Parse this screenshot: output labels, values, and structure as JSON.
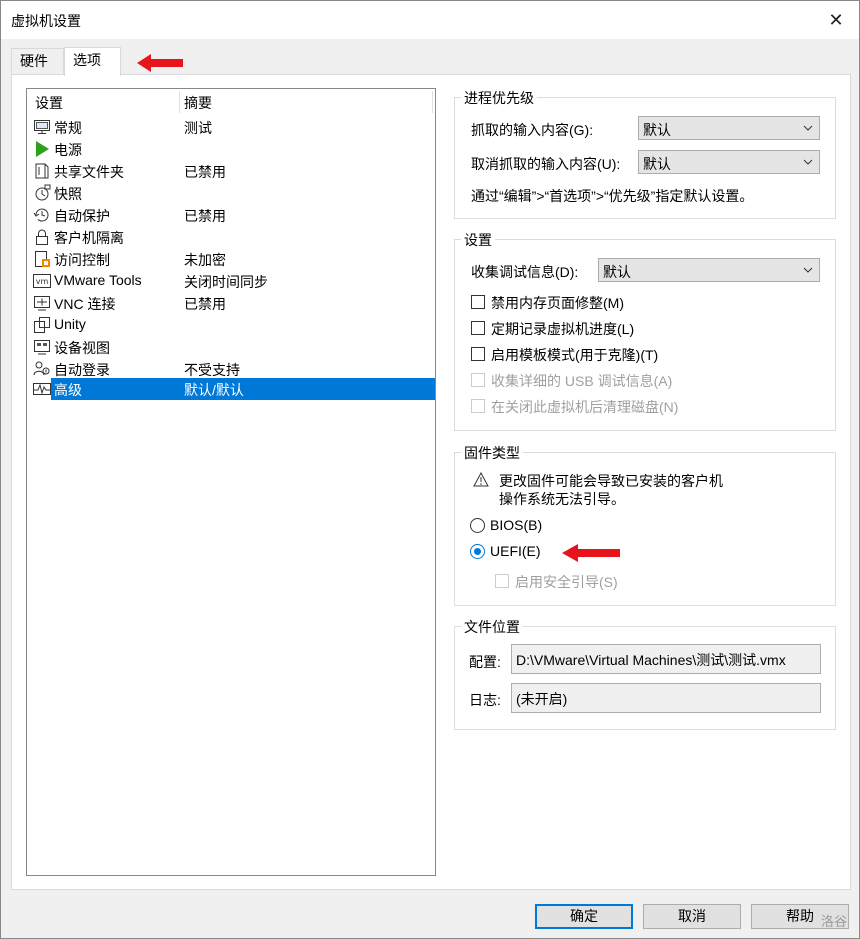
{
  "window": {
    "title": "虚拟机设置",
    "close_glyph": "✕"
  },
  "tabs": [
    {
      "label": "硬件"
    },
    {
      "label": "选项"
    }
  ],
  "list": {
    "headers": {
      "setting": "设置",
      "summary": "摘要"
    },
    "items": [
      {
        "name": "常规",
        "summary": "测试",
        "icon": "monitor-icon"
      },
      {
        "name": "电源",
        "summary": "",
        "icon": "play-icon"
      },
      {
        "name": "共享文件夹",
        "summary": "已禁用",
        "icon": "folder-share-icon"
      },
      {
        "name": "快照",
        "summary": "",
        "icon": "snapshot-icon"
      },
      {
        "name": "自动保护",
        "summary": "已禁用",
        "icon": "clock-icon"
      },
      {
        "name": "客户机隔离",
        "summary": "",
        "icon": "lock-icon"
      },
      {
        "name": "访问控制",
        "summary": "未加密",
        "icon": "access-control-icon"
      },
      {
        "name": "VMware Tools",
        "summary": "关闭时间同步",
        "icon": "vm-icon"
      },
      {
        "name": "VNC 连接",
        "summary": "已禁用",
        "icon": "vnc-icon"
      },
      {
        "name": "Unity",
        "summary": "",
        "icon": "unity-icon"
      },
      {
        "name": "设备视图",
        "summary": "",
        "icon": "device-view-icon"
      },
      {
        "name": "自动登录",
        "summary": "不受支持",
        "icon": "users-icon"
      },
      {
        "name": "高级",
        "summary": "默认/默认",
        "icon": "pulse-icon"
      }
    ],
    "selected_index": 12
  },
  "process_priority": {
    "title": "进程优先级",
    "grab_label": "抓取的输入内容(G):",
    "grab_value": "默认",
    "ungrab_label": "取消抓取的输入内容(U):",
    "ungrab_value": "默认",
    "hint": "通过“编辑”>“首选项”>“优先级”指定默认设置。"
  },
  "settings": {
    "title": "设置",
    "debug_label": "收集调试信息(D):",
    "debug_value": "默认",
    "checks": [
      {
        "label": "禁用内存页面修整(M)",
        "checked": false,
        "enabled": true
      },
      {
        "label": "定期记录虚拟机进度(L)",
        "checked": false,
        "enabled": true
      },
      {
        "label": "启用模板模式(用于克隆)(T)",
        "checked": false,
        "enabled": true
      },
      {
        "label": "收集详细的 USB 调试信息(A)",
        "checked": false,
        "enabled": false
      },
      {
        "label": "在关闭此虚拟机后清理磁盘(N)",
        "checked": false,
        "enabled": false
      }
    ]
  },
  "firmware": {
    "title": "固件类型",
    "warning_line1": "更改固件可能会导致已安装的客户机",
    "warning_line2": "操作系统无法引导。",
    "bios_label": "BIOS(B)",
    "uefi_label": "UEFI(E)",
    "selected": "UEFI",
    "secure_boot_label": "启用安全引导(S)"
  },
  "file_location": {
    "title": "文件位置",
    "config_label": "配置:",
    "config_value": "D:\\VMware\\Virtual Machines\\测试\\测试.vmx",
    "log_label": "日志:",
    "log_value": "(未开启)"
  },
  "buttons": {
    "ok": "确定",
    "cancel": "取消",
    "help": "帮助"
  },
  "watermark": "洛谷",
  "colors": {
    "selection": "#0078d7",
    "annotation_arrow": "#e8141c",
    "play_green": "#2ea01c"
  }
}
